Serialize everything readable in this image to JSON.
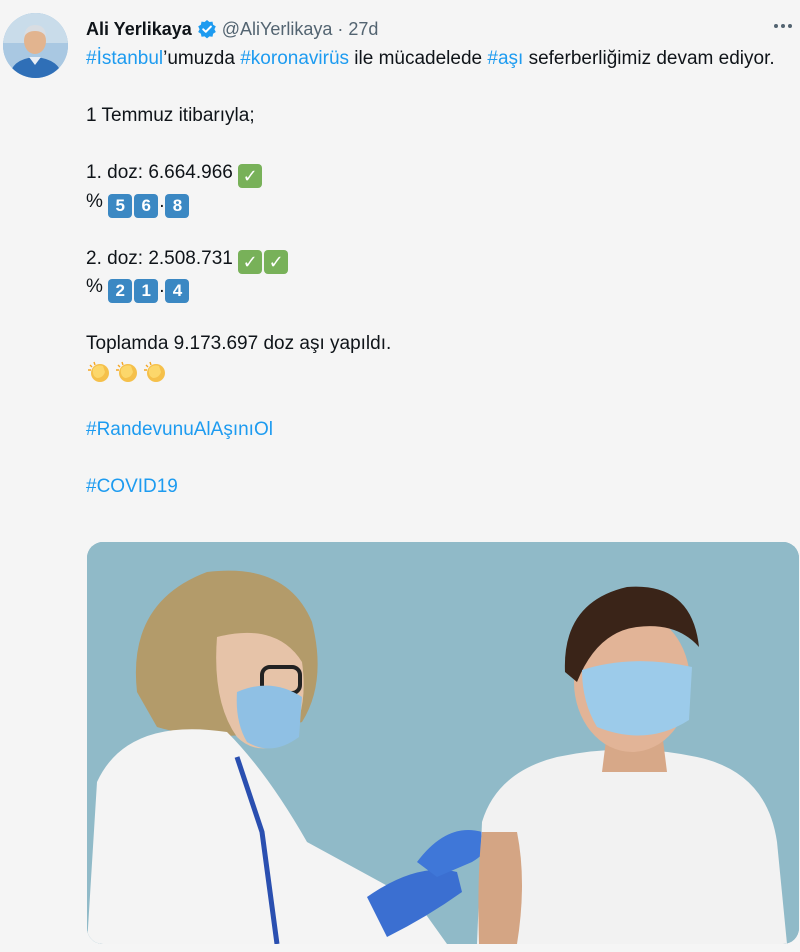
{
  "author": {
    "name": "Ali Yerlikaya",
    "handle": "@AliYerlikaya",
    "separator": "·",
    "time": "27d"
  },
  "tweet": {
    "line1": [
      {
        "text": "#İstanbul",
        "type": "hashtag"
      },
      {
        "text": "’umuzda ",
        "type": "text"
      },
      {
        "text": "#koronavirüs",
        "type": "hashtag"
      },
      {
        "text": " ile mücadelede ",
        "type": "text"
      },
      {
        "text": "#aşı",
        "type": "hashtag"
      },
      {
        "text": " seferberliğimiz devam ediyor.",
        "type": "text"
      }
    ],
    "date_line": "1 Temmuz itibarıyla;",
    "dose1_label": "1. doz: 6.664.966",
    "dose1_percent_prefix": "%",
    "dose1_percent_digits": [
      "5",
      "6",
      "8"
    ],
    "dose2_label": "2. doz: 2.508.731",
    "dose2_percent_prefix": "%",
    "dose2_percent_digits": [
      "2",
      "1",
      "4"
    ],
    "total_line": "Toplamda 9.173.697 doz aşı yapıldı.",
    "hashtag_randevu": "#RandevunuAlAşınıOl",
    "hashtag_covid": "#COVID19",
    "check_glyph": "✓",
    "decimal_sep": "."
  },
  "icons": {
    "verified": "verified-badge-icon",
    "more": "more-options-icon",
    "check": "check-mark-button-emoji",
    "keycap": "keycap-digit-emoji",
    "clap": "clapping-hands-emoji"
  },
  "colors": {
    "hashtag": "#1d9bf0",
    "verified": "#1d9bf0",
    "check_bg": "#78b159",
    "keycap_bg": "#3b88c3",
    "background": "#f5f5f5"
  }
}
